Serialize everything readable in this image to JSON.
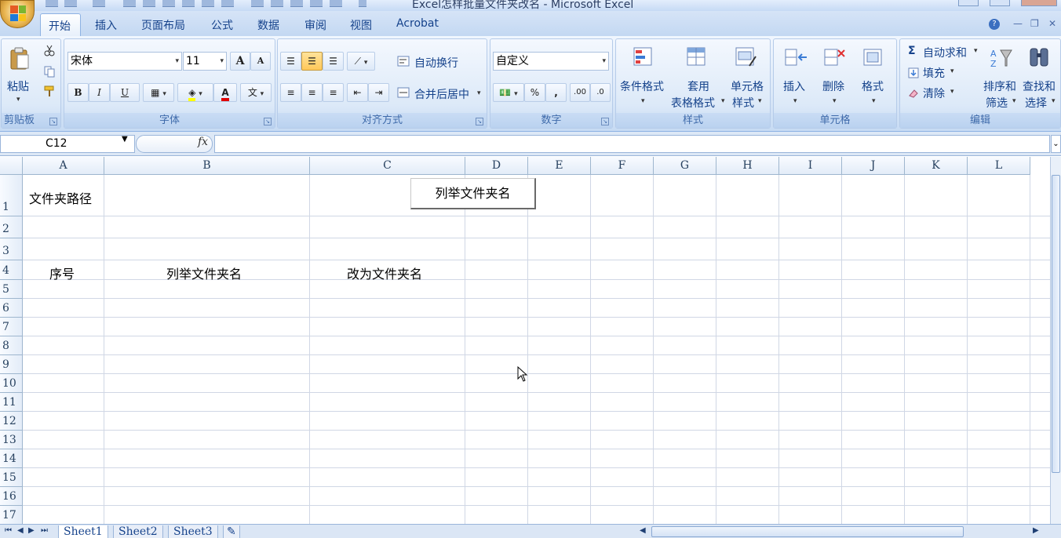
{
  "window": {
    "title": "Excel怎样批量文件夹改名 - Microsoft Excel"
  },
  "ribbon_tabs": [
    "开始",
    "插入",
    "页面布局",
    "公式",
    "数据",
    "审阅",
    "视图",
    "Acrobat"
  ],
  "clipboard": {
    "paste_label": "粘贴",
    "group_label": "剪贴板"
  },
  "font": {
    "name": "宋体",
    "size": "11",
    "bold": "B",
    "italic": "I",
    "underline": "U",
    "grow": "A",
    "shrink": "A",
    "group_label": "字体",
    "font_color_glyph": "A",
    "phonetic_glyph": "文"
  },
  "alignment": {
    "wrap_text": "自动换行",
    "merge_center": "合并后居中",
    "group_label": "对齐方式"
  },
  "number": {
    "format": "自定义",
    "percent": "%",
    "comma": ",",
    "group_label": "数字"
  },
  "styles": {
    "conditional": "条件格式",
    "table_format_1": "套用",
    "table_format_2": "表格格式",
    "cell_styles_1": "单元格",
    "cell_styles_2": "样式",
    "group_label": "样式"
  },
  "cells": {
    "insert": "插入",
    "delete": "删除",
    "format": "格式",
    "group_label": "单元格"
  },
  "editing": {
    "autosum": "自动求和",
    "fill": "填充",
    "clear": "清除",
    "sort_1": "排序和",
    "sort_2": "筛选",
    "find_1": "查找和",
    "find_2": "选择",
    "group_label": "编辑",
    "sigma": "Σ"
  },
  "formula_bar": {
    "name_box": "C12",
    "fx": "fx",
    "formula": ""
  },
  "columns": [
    "A",
    "B",
    "C",
    "D",
    "E",
    "F",
    "G",
    "H",
    "I",
    "J",
    "K",
    "L"
  ],
  "rows": [
    "1",
    "2",
    "3",
    "4",
    "5",
    "6",
    "7",
    "8",
    "9",
    "10",
    "11",
    "12",
    "13",
    "14",
    "15",
    "16",
    "17"
  ],
  "cells_content": {
    "A1": "文件夹路径",
    "A4": "序号",
    "B4": "列举文件夹名",
    "C4": "改为文件夹名"
  },
  "form_button": {
    "label": "列举文件夹名"
  },
  "sheets": [
    "Sheet1",
    "Sheet2",
    "Sheet3"
  ],
  "help_icon": "?"
}
